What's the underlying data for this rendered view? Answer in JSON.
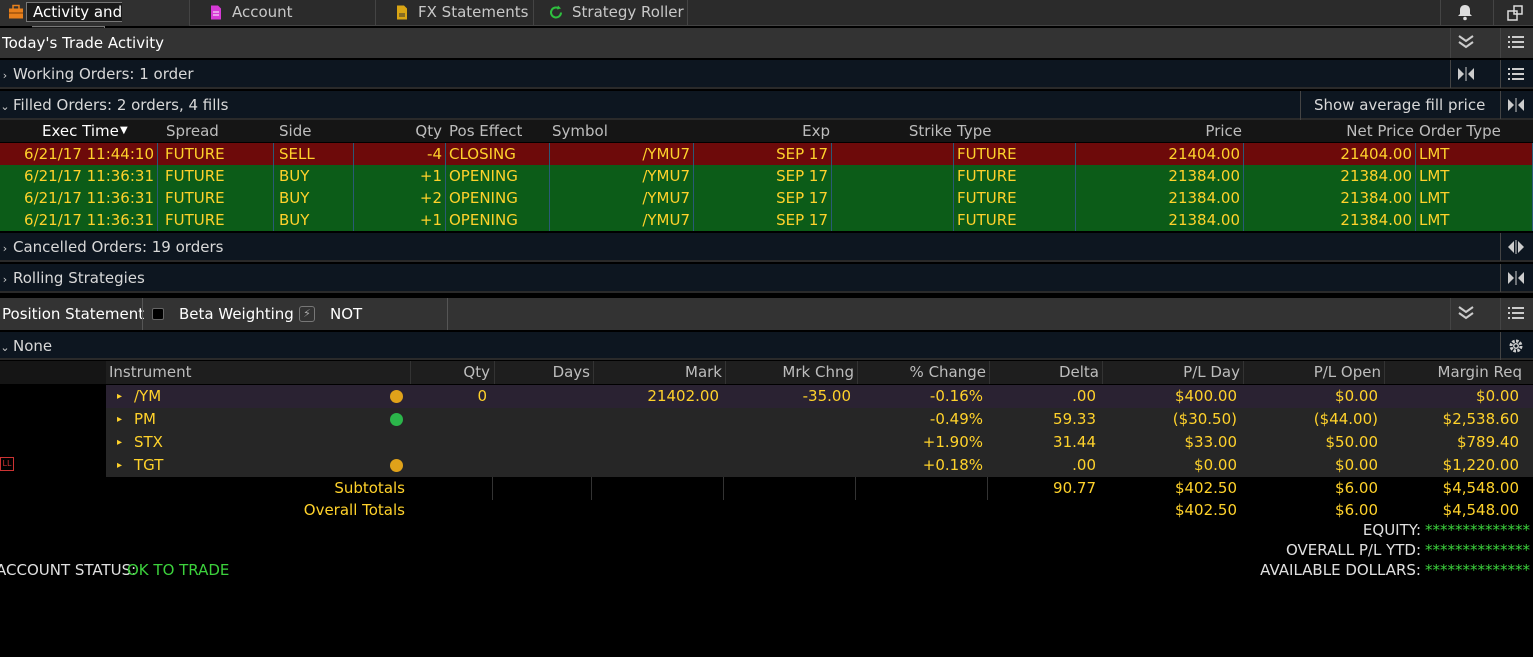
{
  "tabs": [
    {
      "label": "Activity and Positions",
      "icon": "briefcase-icon",
      "active": true
    },
    {
      "label": "Account Statement",
      "icon": "document-icon"
    },
    {
      "label": "FX Statements",
      "icon": "fx-document-icon"
    },
    {
      "label": "Strategy Roller",
      "icon": "refresh-icon"
    }
  ],
  "trade_activity": {
    "title": "Today's Trade Activity",
    "working_orders": "Working Orders: 1 order",
    "filled_orders": "Filled Orders: 2 orders, 4 fills",
    "show_avg_fill": "Show average fill prices",
    "columns": [
      "Exec Time",
      "Spread",
      "Side",
      "Qty",
      "Pos Effect",
      "Symbol",
      "Exp",
      "Strike",
      "Type",
      "Price",
      "Net Price",
      "Order Type"
    ],
    "fills": [
      {
        "exec_time": "6/21/17 11:44:10",
        "spread": "FUTURE",
        "side": "SELL",
        "qty": "-4",
        "pos_effect": "CLOSING",
        "symbol": "/YMU7",
        "exp": "SEP 17",
        "strike": "",
        "type": "FUTURE",
        "price": "21404.00",
        "net_price": "21404.00",
        "order_type": "LMT"
      },
      {
        "exec_time": "6/21/17 11:36:31",
        "spread": "FUTURE",
        "side": "BUY",
        "qty": "+1",
        "pos_effect": "OPENING",
        "symbol": "/YMU7",
        "exp": "SEP 17",
        "strike": "",
        "type": "FUTURE",
        "price": "21384.00",
        "net_price": "21384.00",
        "order_type": "LMT"
      },
      {
        "exec_time": "6/21/17 11:36:31",
        "spread": "FUTURE",
        "side": "BUY",
        "qty": "+2",
        "pos_effect": "OPENING",
        "symbol": "/YMU7",
        "exp": "SEP 17",
        "strike": "",
        "type": "FUTURE",
        "price": "21384.00",
        "net_price": "21384.00",
        "order_type": "LMT"
      },
      {
        "exec_time": "6/21/17 11:36:31",
        "spread": "FUTURE",
        "side": "BUY",
        "qty": "+1",
        "pos_effect": "OPENING",
        "symbol": "/YMU7",
        "exp": "SEP 17",
        "strike": "",
        "type": "FUTURE",
        "price": "21384.00",
        "net_price": "21384.00",
        "order_type": "LMT"
      }
    ],
    "cancelled_orders": "Cancelled Orders: 19 orders",
    "rolling_strategies": "Rolling Strategies"
  },
  "position_statement": {
    "title": "Position Statement",
    "beta_weighting": "Beta Weighting",
    "weighting_value": "NOT WEIGHTED",
    "group": "None",
    "columns": [
      "Instrument",
      "Qty",
      "Days",
      "Mark",
      "Mrk Chng",
      "% Change",
      "Delta",
      "P/L Day",
      "P/L Open",
      "Margin Req"
    ],
    "positions": [
      {
        "instrument": "/YM",
        "qty": "0",
        "days": "",
        "mark": "21402.00",
        "mrk_chng": "-35.00",
        "pct_change": "-0.16%",
        "delta": ".00",
        "pl_day": "$400.00",
        "pl_open": "$0.00",
        "margin_req": "$0.00",
        "badge_color": "#e0a21a"
      },
      {
        "instrument": "PM",
        "qty": "",
        "days": "",
        "mark": "",
        "mrk_chng": "",
        "pct_change": "-0.49%",
        "delta": "59.33",
        "pl_day": "($30.50)",
        "pl_open": "($44.00)",
        "margin_req": "$2,538.60",
        "badge_color": "#2bb54a"
      },
      {
        "instrument": "STX",
        "qty": "",
        "days": "",
        "mark": "",
        "mrk_chng": "",
        "pct_change": "+1.90%",
        "delta": "31.44",
        "pl_day": "$33.00",
        "pl_open": "$50.00",
        "margin_req": "$789.40",
        "badge_color": ""
      },
      {
        "instrument": "TGT",
        "qty": "",
        "days": "",
        "mark": "",
        "mrk_chng": "",
        "pct_change": "+0.18%",
        "delta": ".00",
        "pl_day": "$0.00",
        "pl_open": "$0.00",
        "margin_req": "$1,220.00",
        "badge_color": "#e0a21a"
      }
    ],
    "side_label": "LL",
    "subtotals": {
      "label": "Subtotals",
      "delta": "90.77",
      "pl_day": "$402.50",
      "pl_open": "$6.00",
      "margin_req": "$4,548.00"
    },
    "overall_totals": {
      "label": "Overall Totals",
      "pl_day": "$402.50",
      "pl_open": "$6.00",
      "margin_req": "$4,548.00"
    },
    "equity_label": "EQUITY:",
    "overall_pl_label": "OVERALL P/L YTD:",
    "available_label": "AVAILABLE DOLLARS:",
    "masked_value": "**************",
    "account_status_label": "ACCOUNT STATUS:",
    "account_status_value": "OK TO TRADE"
  }
}
